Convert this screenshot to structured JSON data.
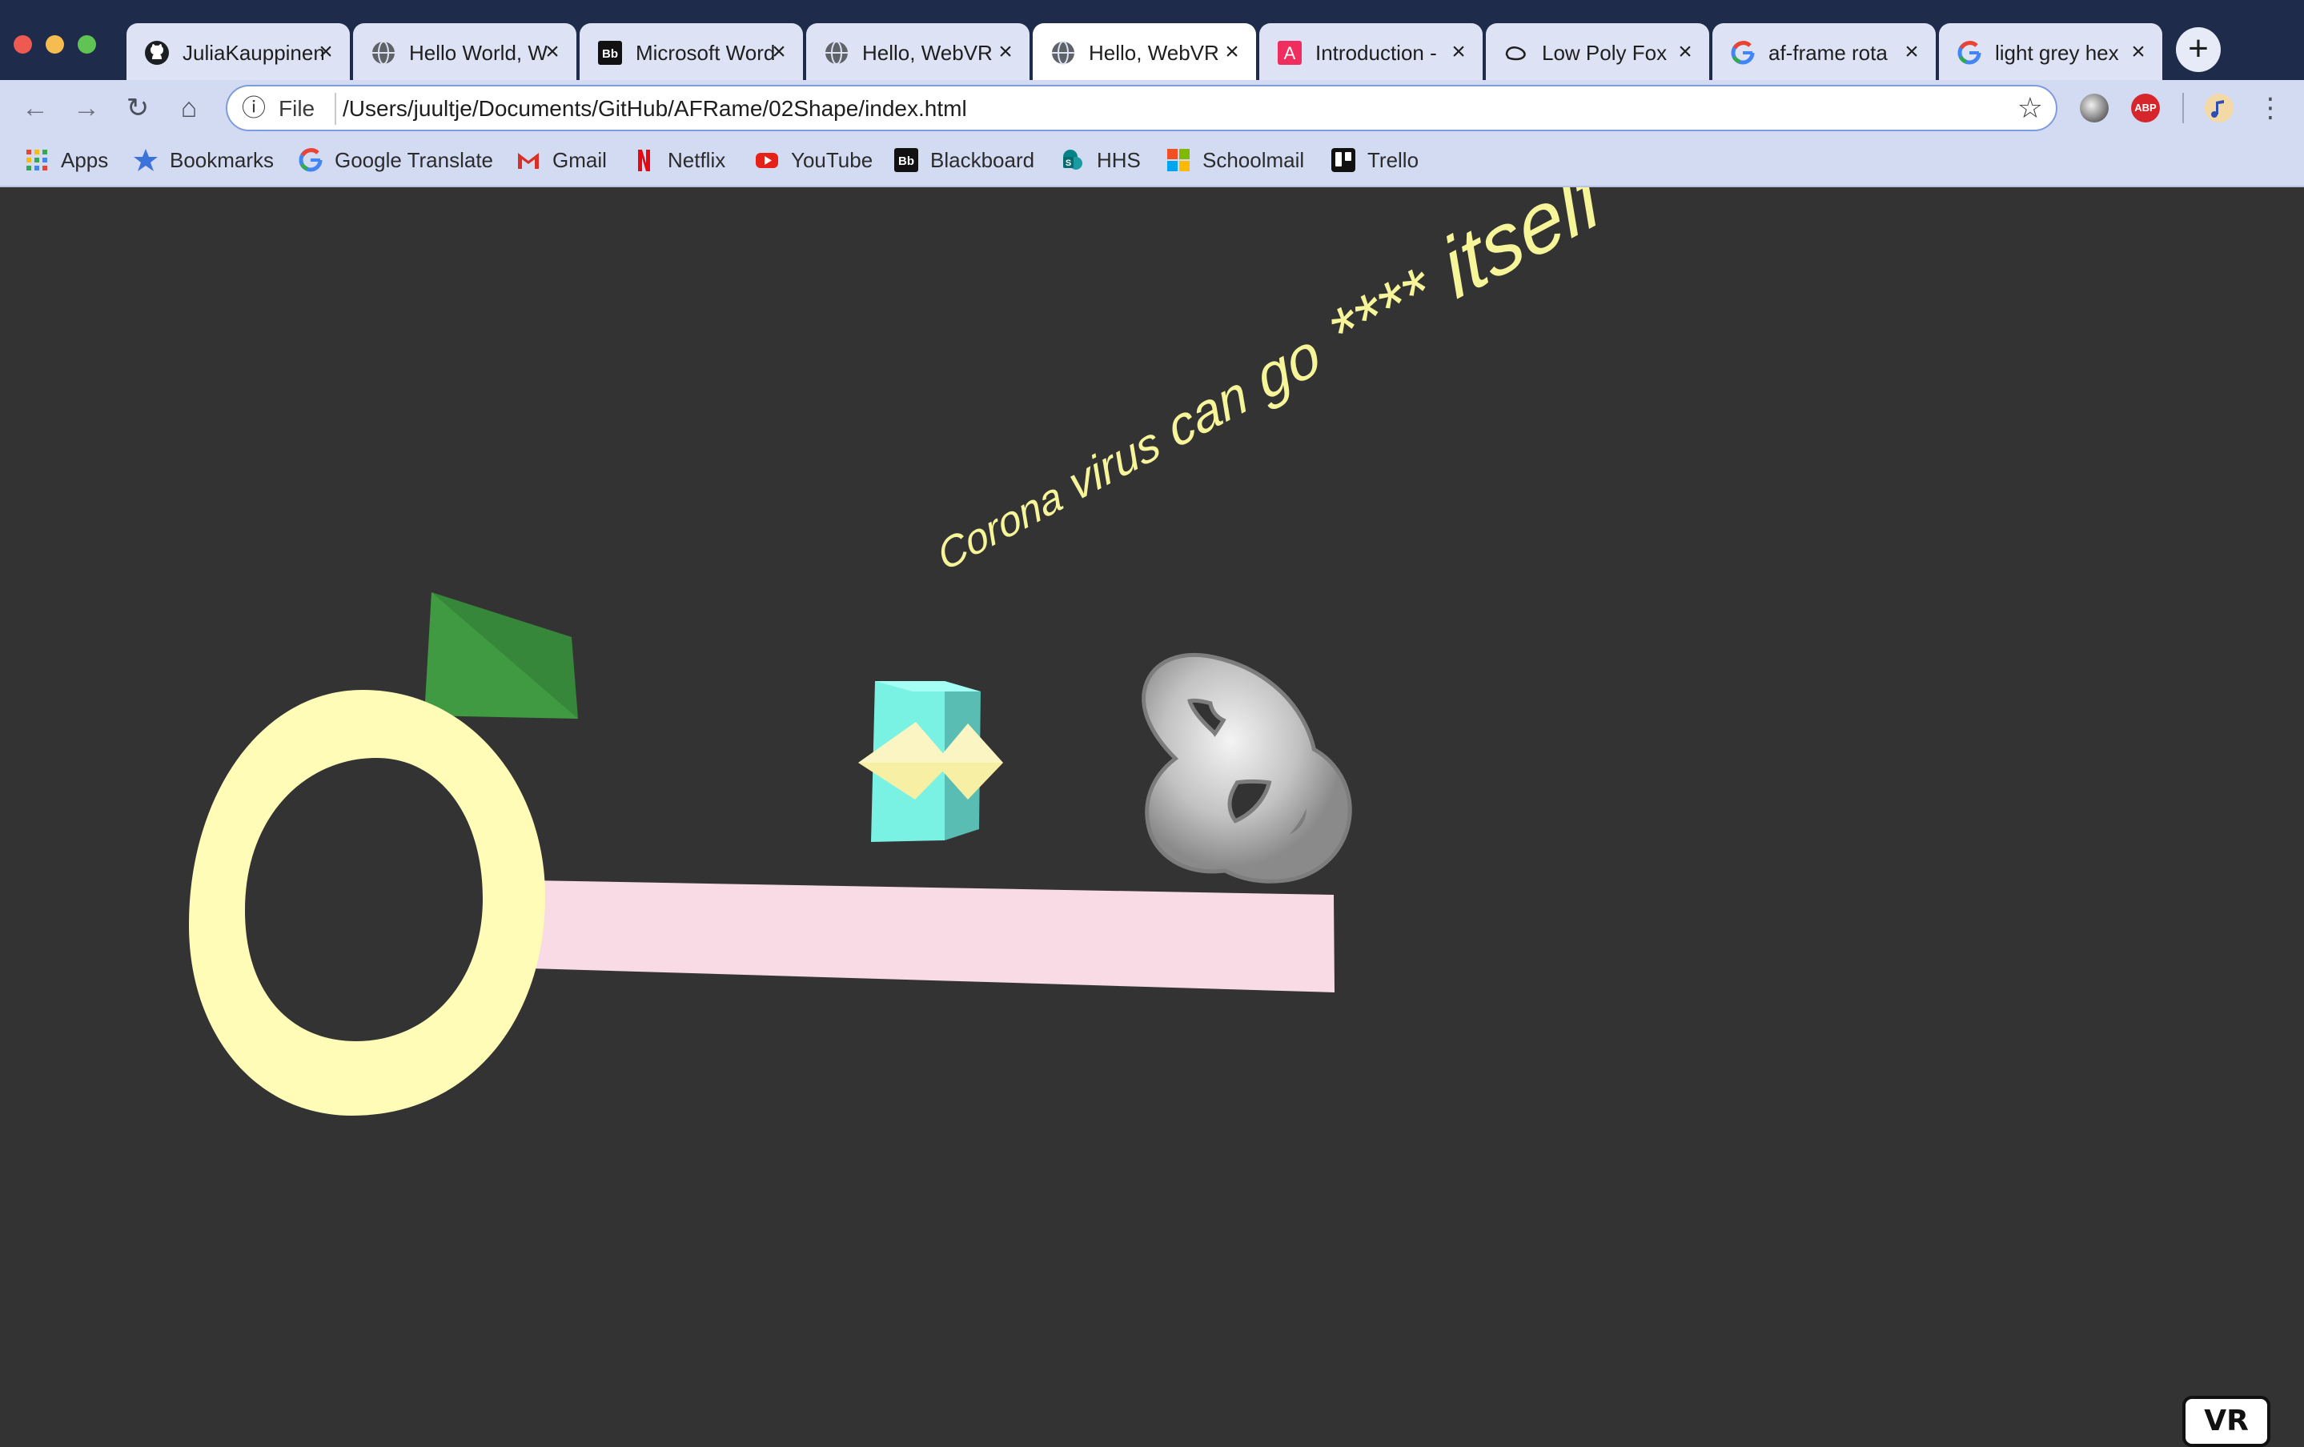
{
  "window": {
    "traffic_lights": [
      "#ee5a52",
      "#f5bd4f",
      "#5fc454"
    ]
  },
  "tabs": [
    {
      "title": "JuliaKauppinen",
      "icon": "github-icon",
      "active": false
    },
    {
      "title": "Hello World, W",
      "icon": "globe-icon",
      "active": false
    },
    {
      "title": "Microsoft Word",
      "icon": "blackboard-icon",
      "active": false
    },
    {
      "title": "Hello, WebVR",
      "icon": "globe-icon",
      "active": false
    },
    {
      "title": "Hello, WebVR",
      "icon": "globe-icon",
      "active": true
    },
    {
      "title": "Introduction -",
      "icon": "aframe-icon",
      "active": false
    },
    {
      "title": "Low Poly Fox",
      "icon": "sketchfab-icon",
      "active": false
    },
    {
      "title": "af-frame rota",
      "icon": "google-icon",
      "active": false
    },
    {
      "title": "light grey hex",
      "icon": "google-icon",
      "active": false
    }
  ],
  "toolbar": {
    "new_tab": "+",
    "back": "←",
    "forward": "→",
    "reload": "↻",
    "home": "⌂",
    "info": "ⓘ",
    "scheme": "File",
    "url": "/Users/juultje/Documents/GitHub/AFRame/02Shape/index.html",
    "bookmark_star": "☆",
    "adblock": "ABP",
    "menu": "⋮"
  },
  "bookmarks": [
    {
      "label": "Apps",
      "icon": "apps-grid-icon"
    },
    {
      "label": "Bookmarks",
      "icon": "star-icon"
    },
    {
      "label": "Google Translate",
      "icon": "google-icon"
    },
    {
      "label": "Gmail",
      "icon": "gmail-icon"
    },
    {
      "label": "Netflix",
      "icon": "netflix-icon"
    },
    {
      "label": "YouTube",
      "icon": "youtube-icon"
    },
    {
      "label": "Blackboard",
      "icon": "blackboard-icon"
    },
    {
      "label": "HHS",
      "icon": "sharepoint-icon"
    },
    {
      "label": "Schoolmail",
      "icon": "microsoft-icon"
    },
    {
      "label": "Trello",
      "icon": "trello-icon"
    }
  ],
  "scene": {
    "background": "#333333",
    "text": "Corona virus can go **** itself",
    "text_color": "#f7f59a",
    "ring_color": "#fffcb8",
    "plane_color": "#f8dbe5",
    "cone_color": "#3f9a42",
    "box_color": "#79f2e4",
    "octahedron_color": "#f7f0a4",
    "knot_color": "#cfcfcf",
    "vr_button": "VR"
  }
}
